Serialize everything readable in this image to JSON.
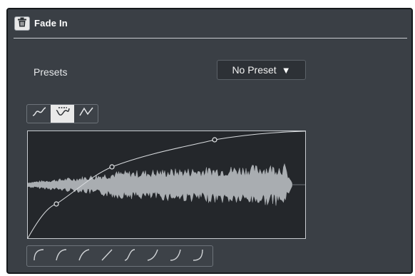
{
  "panel": {
    "title": "Fade In"
  },
  "presets": {
    "label": "Presets",
    "selected": "No Preset",
    "arrow": "▼"
  },
  "curve_types": [
    {
      "name": "spline-interpolation",
      "active": false
    },
    {
      "name": "damped-spline-interpolation",
      "active": true
    },
    {
      "name": "linear-interpolation",
      "active": false
    }
  ],
  "fade_curve": {
    "control_points_count": 3
  },
  "curve_shapes": [
    "strong-log-shape",
    "medium-log-shape",
    "soft-log-shape",
    "linear-shape",
    "s-curve-shape",
    "soft-exp-shape",
    "medium-exp-shape",
    "strong-exp-shape"
  ],
  "colors": {
    "panel_bg": "#3a3f45",
    "editor_bg": "#24272b",
    "waveform": "#a9adb1",
    "curve": "#d9dcdf"
  }
}
